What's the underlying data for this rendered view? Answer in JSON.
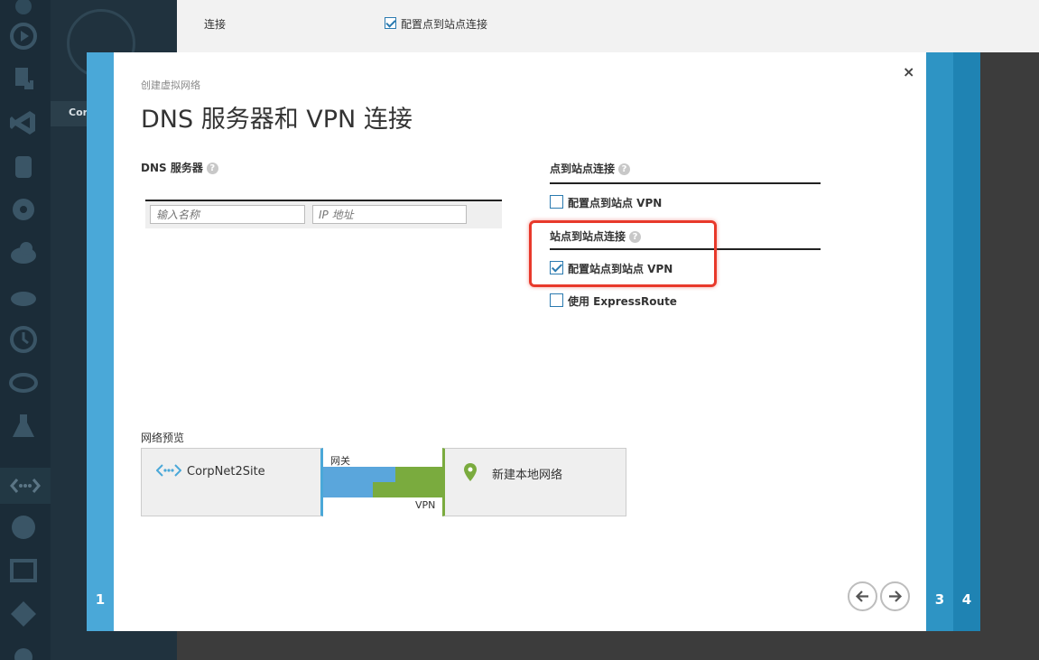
{
  "background": {
    "tab_label": "Corp",
    "connection_label": "连接",
    "connection_checkbox_label": "配置点到站点连接",
    "connection_checked": true
  },
  "wizard": {
    "subtitle": "创建虚拟网络",
    "title": "DNS 服务器和 VPN 连接",
    "close_symbol": "×",
    "steps": [
      "1",
      "3",
      "4"
    ]
  },
  "dns": {
    "label": "DNS 服务器",
    "help": "?",
    "name_placeholder": "输入名称",
    "ip_placeholder": "IP 地址"
  },
  "point_to_site": {
    "title": "点到站点连接",
    "help": "?",
    "checkbox_label": "配置点到站点 VPN",
    "checked": false
  },
  "site_to_site": {
    "title": "站点到站点连接",
    "help": "?",
    "checkbox_label": "配置站点到站点 VPN",
    "checked": true,
    "express_label": "使用 ExpressRoute",
    "express_checked": false
  },
  "preview": {
    "label": "网络预览",
    "left_node": "CorpNet2Site",
    "right_node": "新建本地网络",
    "gateway_label": "网关",
    "vpn_label": "VPN"
  },
  "colors": {
    "accent_blue": "#4aa8d8",
    "accent_green": "#7aab3e",
    "highlight_red": "#e8392b"
  },
  "icons": {
    "prev": "arrow-left-icon",
    "next": "arrow-right-icon",
    "network": "virtual-network-icon",
    "location": "map-pin-icon"
  }
}
